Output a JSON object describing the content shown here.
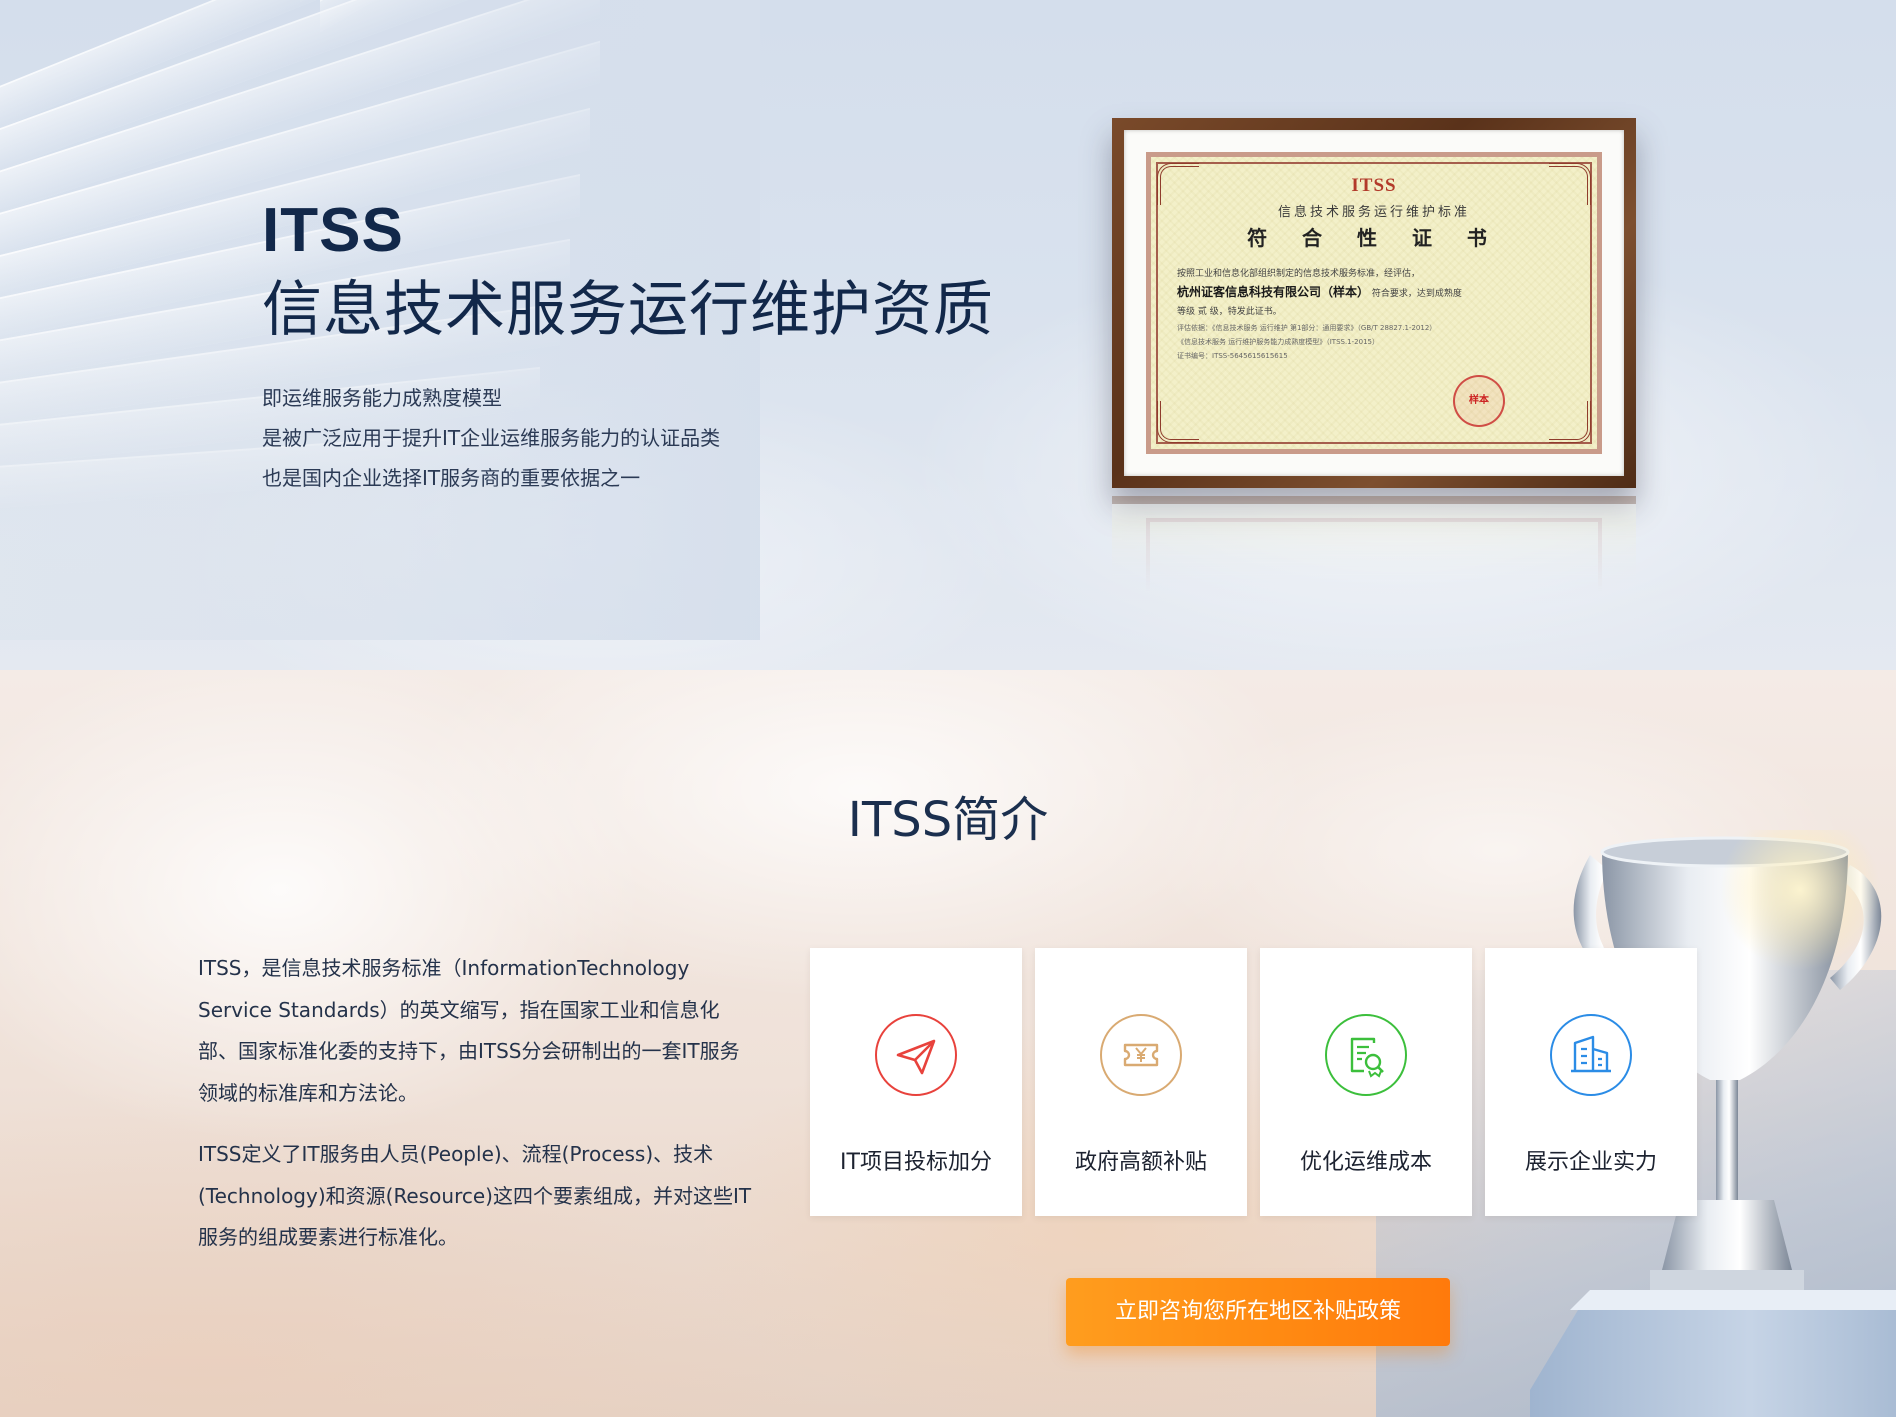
{
  "hero": {
    "title": "ITSS",
    "subtitle": "信息技术服务运行维护资质",
    "description": [
      "即运维服务能力成熟度模型",
      "是被广泛应用于提升IT企业运维服务能力的认证品类",
      "也是国内企业选择IT服务商的重要依据之一"
    ],
    "certificate": {
      "logo": "ITSS",
      "standard_line": "信息技术服务运行维护标准",
      "heading": "符 合 性 证 书",
      "body_line1": "按照工业和信息化部组织制定的信息技术服务标准，经评估，",
      "company": "杭州证客信息科技有限公司（样本）",
      "body_line2_suffix": "符合要求，达到成熟度",
      "body_line3": "等级 贰 级，特发此证书。",
      "basis": "评估依据：《信息技术服务 运行维护 第1部分：通用要求》（GB/T 28827.1-2012）",
      "basis2": "《信息技术服务 运行维护服务能力成熟度模型》（ITSS.1-2015）",
      "cert_no": "证书编号：ITSS-5645615615615",
      "seal": "样本"
    }
  },
  "intro": {
    "title": "ITSS简介",
    "paragraphs": [
      "ITSS，是信息技术服务标准（InformationTechnology Service Standards）的英文缩写，指在国家工业和信息化部、国家标准化委的支持下，由ITSS分会研制出的一套IT服务领域的标准库和方法论。",
      "ITSS定义了IT服务由人员(People)、流程(Process)、技术(Technology)和资源(Resource)这四个要素组成，并对这些IT服务的组成要素进行标准化。"
    ],
    "cards": [
      {
        "label": "IT项目投标加分",
        "icon": "paper-plane-icon",
        "color": "#e8423c"
      },
      {
        "label": "政府高额补贴",
        "icon": "yuan-ticket-icon",
        "color": "#d9aa72"
      },
      {
        "label": "优化运维成本",
        "icon": "document-search-icon",
        "color": "#3cbf3c"
      },
      {
        "label": "展示企业实力",
        "icon": "buildings-icon",
        "color": "#2b8ce6"
      }
    ],
    "cta_label": "立即咨询您所在地区补贴政策"
  }
}
